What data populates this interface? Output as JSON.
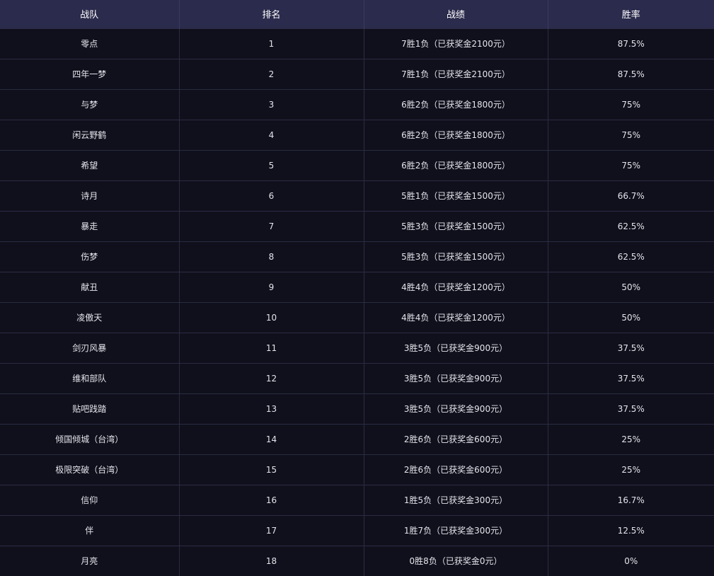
{
  "table": {
    "headers": [
      "战队",
      "排名",
      "战绩",
      "胜率"
    ],
    "rows": [
      [
        "零点",
        "1",
        "7胜1负（已获奖金2100元）",
        "87.5%"
      ],
      [
        "四年一梦",
        "2",
        "7胜1负（已获奖金2100元）",
        "87.5%"
      ],
      [
        "与梦",
        "3",
        "6胜2负（已获奖金1800元）",
        "75%"
      ],
      [
        "闲云野鹤",
        "4",
        "6胜2负（已获奖金1800元）",
        "75%"
      ],
      [
        "希望",
        "5",
        "6胜2负（已获奖金1800元）",
        "75%"
      ],
      [
        "诗月",
        "6",
        "5胜1负（已获奖金1500元）",
        "66.7%"
      ],
      [
        "暴走",
        "7",
        "5胜3负（已获奖金1500元）",
        "62.5%"
      ],
      [
        "伤梦",
        "8",
        "5胜3负（已获奖金1500元）",
        "62.5%"
      ],
      [
        "献丑",
        "9",
        "4胜4负（已获奖金1200元）",
        "50%"
      ],
      [
        "凌傲天",
        "10",
        "4胜4负（已获奖金1200元）",
        "50%"
      ],
      [
        "剑刃风暴",
        "11",
        "3胜5负（已获奖金900元）",
        "37.5%"
      ],
      [
        "维和部队",
        "12",
        "3胜5负（已获奖金900元）",
        "37.5%"
      ],
      [
        "贴吧践踏",
        "13",
        "3胜5负（已获奖金900元）",
        "37.5%"
      ],
      [
        "倾国倾城（台湾）",
        "14",
        "2胜6负（已获奖金600元）",
        "25%"
      ],
      [
        "极限突破（台湾）",
        "15",
        "2胜6负（已获奖金600元）",
        "25%"
      ],
      [
        "信仰",
        "16",
        "1胜5负（已获奖金300元）",
        "16.7%"
      ],
      [
        "伴",
        "17",
        "1胜7负（已获奖金300元）",
        "12.5%"
      ],
      [
        "月亮",
        "18",
        "0胜8负（已获奖金0元）",
        "0%"
      ]
    ]
  }
}
